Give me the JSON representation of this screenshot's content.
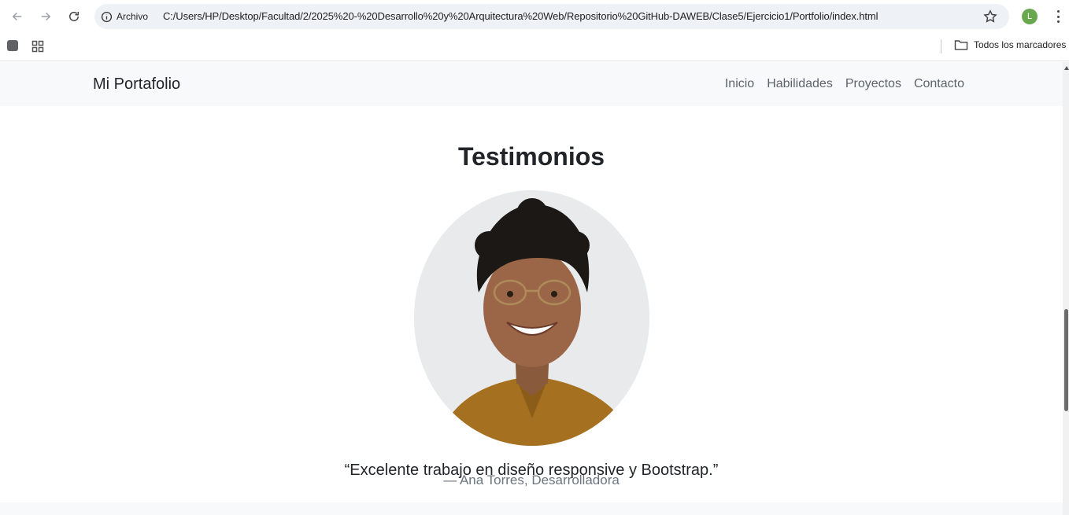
{
  "browser": {
    "chip_label": "Archivo",
    "url": "C:/Users/HP/Desktop/Facultad/2/2025%20-%20Desarrollo%20y%20Arquitectura%20Web/Repositorio%20GitHub-DAWEB/Clase5/Ejercicio1/Portfolio/index.html",
    "profile_initial": "L",
    "profile_color": "#6aa84f",
    "bookmarks_folder": "Todos los marcadores"
  },
  "site": {
    "brand": "Mi Portafolio",
    "nav": [
      "Inicio",
      "Habilidades",
      "Proyectos",
      "Contacto"
    ]
  },
  "testimonials": {
    "heading": "Testimonios",
    "quote": "“Excelente trabajo en diseño responsive y Bootstrap.”",
    "author": "— Ana Torres, Desarrolladora"
  },
  "icons": [
    "back-arrow-icon",
    "forward-arrow-icon",
    "reload-icon",
    "info-icon",
    "star-icon",
    "kebab-menu-icon",
    "apps-grid-icon",
    "folder-icon"
  ],
  "colors": {
    "navbar_bg": "#f8f9fa",
    "text_dark": "#212529",
    "text_muted": "#6c757d",
    "omnibox_bg": "#eef1f6"
  }
}
